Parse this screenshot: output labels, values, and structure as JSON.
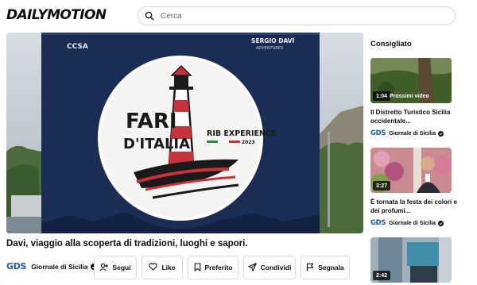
{
  "header": {
    "logo_text": "DAILYMOTION",
    "search": {
      "placeholder": "Cerca",
      "value": ""
    },
    "search_icon": "search-icon"
  },
  "player": {
    "banner": {
      "partner_logo_text": "CCSA",
      "sponsor_line1": "SERGIO DAVÌ",
      "sponsor_line2": "ADVENTURES",
      "title_line1": "FARI",
      "title_line2": "D'ITALIA",
      "subtitle": "RIB EXPERIENCE",
      "year": "2023"
    }
  },
  "video": {
    "title": "Davi, viaggio alla scoperta di tradizioni, luoghi e sapori."
  },
  "channel": {
    "logo_text": "GDS",
    "name": "Giornale di Sicilia",
    "verified_icon": "verified-icon"
  },
  "actions": {
    "follow": {
      "label": "Segui",
      "icon": "user-plus-icon"
    },
    "like": {
      "label": "Like",
      "icon": "heart-icon"
    },
    "favorite": {
      "label": "Preferito",
      "icon": "bookmark-icon"
    },
    "share": {
      "label": "Condividi",
      "icon": "send-icon"
    },
    "report": {
      "label": "Segnala",
      "icon": "flag-icon"
    }
  },
  "recommended": {
    "heading": "Consigliato",
    "items": [
      {
        "duration": "1:04",
        "next_label": "Prossimi video",
        "title": "Il Distretto Turistico Sicilia occidentale...",
        "channel_logo": "GDS",
        "channel": "Giornale di Sicilia"
      },
      {
        "duration": "3:27",
        "title": "È tornata la festa dei colori e dei profumi...",
        "channel_logo": "GDS",
        "channel": "Giornale di Sicilia"
      },
      {
        "duration": "2:42"
      }
    ]
  },
  "colors": {
    "brand_blue": "#1f5da8",
    "banner_navy": "#1b2d55",
    "lighthouse_red": "#c8323a",
    "text": "#0d0d0d"
  }
}
